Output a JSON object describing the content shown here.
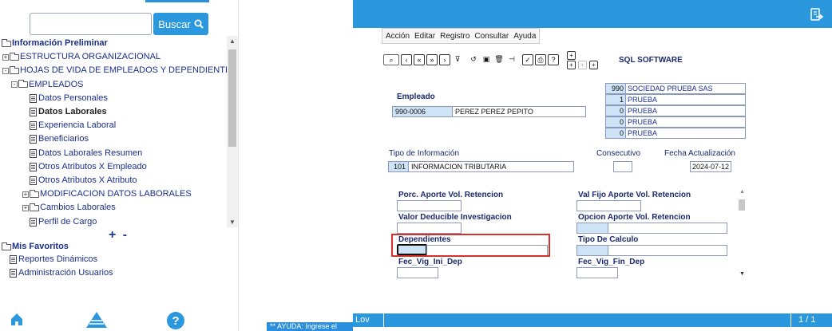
{
  "left_panel": {
    "search": {
      "placeholder": "",
      "button_label": "Buscar"
    },
    "tree": [
      {
        "label": "Información Preliminar",
        "level": 0,
        "kind": "folder-open",
        "bold": true
      },
      {
        "label": "ESTRUCTURA ORGANIZACIONAL",
        "level": 1,
        "kind": "folder",
        "expander": "+"
      },
      {
        "label": "HOJAS DE VIDA DE EMPLEADOS Y DEPENDIENTES",
        "level": 1,
        "kind": "folder-open",
        "expander": "-"
      },
      {
        "label": "EMPLEADOS",
        "level": 2,
        "kind": "folder-open",
        "expander": "-"
      },
      {
        "label": "Datos Personales",
        "level": 3,
        "kind": "doc"
      },
      {
        "label": "Datos Laborales",
        "level": 3,
        "kind": "doc",
        "bold": true
      },
      {
        "label": "Experiencia Laboral",
        "level": 3,
        "kind": "doc"
      },
      {
        "label": "Beneficiarios",
        "level": 3,
        "kind": "doc"
      },
      {
        "label": "Datos Laborales Resumen",
        "level": 3,
        "kind": "doc"
      },
      {
        "label": "Otros Atributos X Empleado",
        "level": 3,
        "kind": "doc"
      },
      {
        "label": "Otros Atributos X Atributo",
        "level": 3,
        "kind": "doc"
      },
      {
        "label": "MODIFICACION DATOS LABORALES",
        "level": 3,
        "kind": "folder",
        "expander": "+"
      },
      {
        "label": "Cambios Laborales",
        "level": 3,
        "kind": "folder",
        "expander": "+"
      },
      {
        "label": "Perfil de Cargo",
        "level": 3,
        "kind": "doc"
      }
    ],
    "expand_collapse": "+ -",
    "favorites": {
      "title": "Mis Favoritos",
      "items": [
        "Reportes Dinámicos",
        "Administración Usuarios"
      ]
    }
  },
  "middle": {
    "help_bar": "** AYUDA: Ingrese el"
  },
  "app": {
    "menu": [
      "Acción",
      "Editar",
      "Registro",
      "Consultar",
      "Ayuda"
    ],
    "toolbar_icons": [
      "binoculars-icon",
      "first-icon",
      "prev-page-icon",
      "next-page-icon",
      "last-icon",
      "filter-icon",
      "undo-icon",
      "save-icon",
      "delete-icon",
      "exit-record-icon",
      "check-icon",
      "print-icon",
      "help-icon"
    ],
    "brand": "SQL SOFTWARE",
    "empleado": {
      "label": "Empleado",
      "code": "990-0006",
      "name": "PEREZ PEREZ PEPITO"
    },
    "company_rows": [
      {
        "num": "990",
        "text": "SOCIEDAD  PRUEBA SAS"
      },
      {
        "num": "1",
        "text": "PRUEBA"
      },
      {
        "num": "0",
        "text": "PRUEBA"
      },
      {
        "num": "0",
        "text": "PRUEBA"
      },
      {
        "num": "0",
        "text": "PRUEBA"
      }
    ],
    "tipo_info": {
      "label": "Tipo de Información",
      "code": "101",
      "text": "INFORMACION TRIBUTARIA"
    },
    "consecutivo": {
      "label": "Consecutivo",
      "value": ""
    },
    "fecha": {
      "label": "Fecha Actualización",
      "value": "2024-07-12"
    },
    "fields": {
      "porc_aporte": "Porc. Aporte Vol. Retencion",
      "val_fijo": "Val Fijo Aporte Vol. Retencion",
      "valor_deducible": "Valor Deducible Investigacion",
      "opcion_aporte": "Opcion Aporte Vol. Retencion",
      "dependientes": "Dependientes",
      "tipo_calculo": "Tipo De Calculo",
      "fec_ini": "Fec_Vig_Ini_Dep",
      "fec_fin": "Fec_Vig_Fin_Dep"
    },
    "status": {
      "left": "Lov",
      "right": "1 / 1"
    }
  }
}
